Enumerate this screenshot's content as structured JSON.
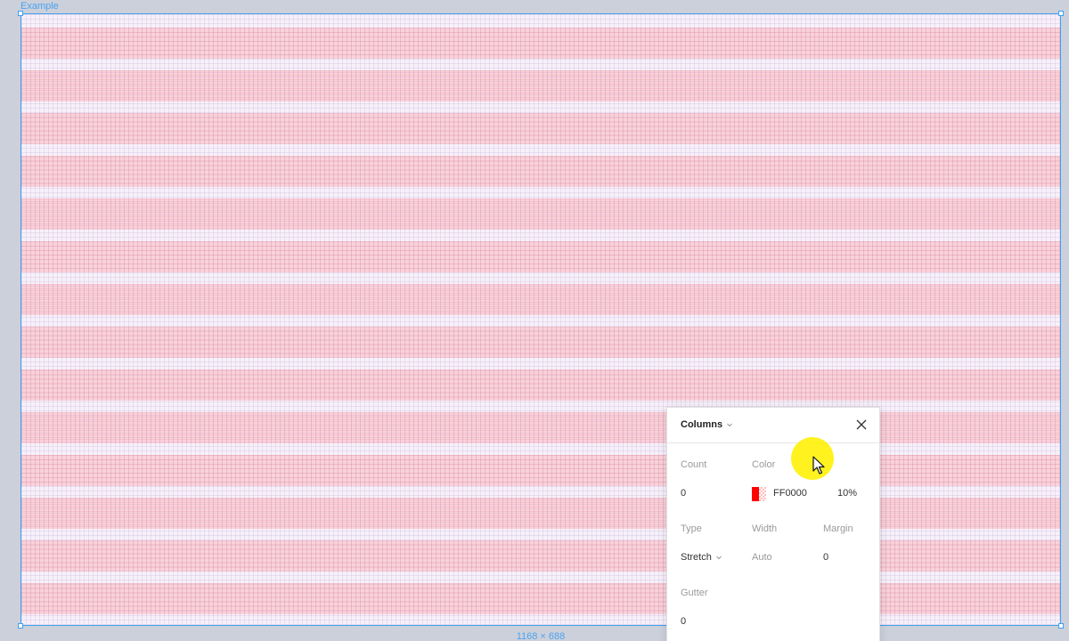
{
  "frame": {
    "name": "Example",
    "size_label": "1168 × 688",
    "accent_color": "#3fa0f0"
  },
  "layout_grid": {
    "type": "rows",
    "band_color": "#FF0000",
    "band_opacity": "10%"
  },
  "panel": {
    "title": "Columns",
    "title_chevron_icon": "chevron-down-icon",
    "close_icon": "close-icon",
    "count": {
      "label": "Count",
      "value": "0"
    },
    "color": {
      "label": "Color",
      "hex": "FF0000",
      "opacity": "10%",
      "swatch": "#ff0000"
    },
    "type": {
      "label": "Type",
      "value": "Stretch"
    },
    "width": {
      "label": "Width",
      "value": "Auto"
    },
    "margin": {
      "label": "Margin",
      "value": "0"
    },
    "gutter": {
      "label": "Gutter",
      "value": "0"
    }
  },
  "cursor": {
    "icon": "arrow-cursor-icon",
    "highlight_color": "#ffef00"
  }
}
